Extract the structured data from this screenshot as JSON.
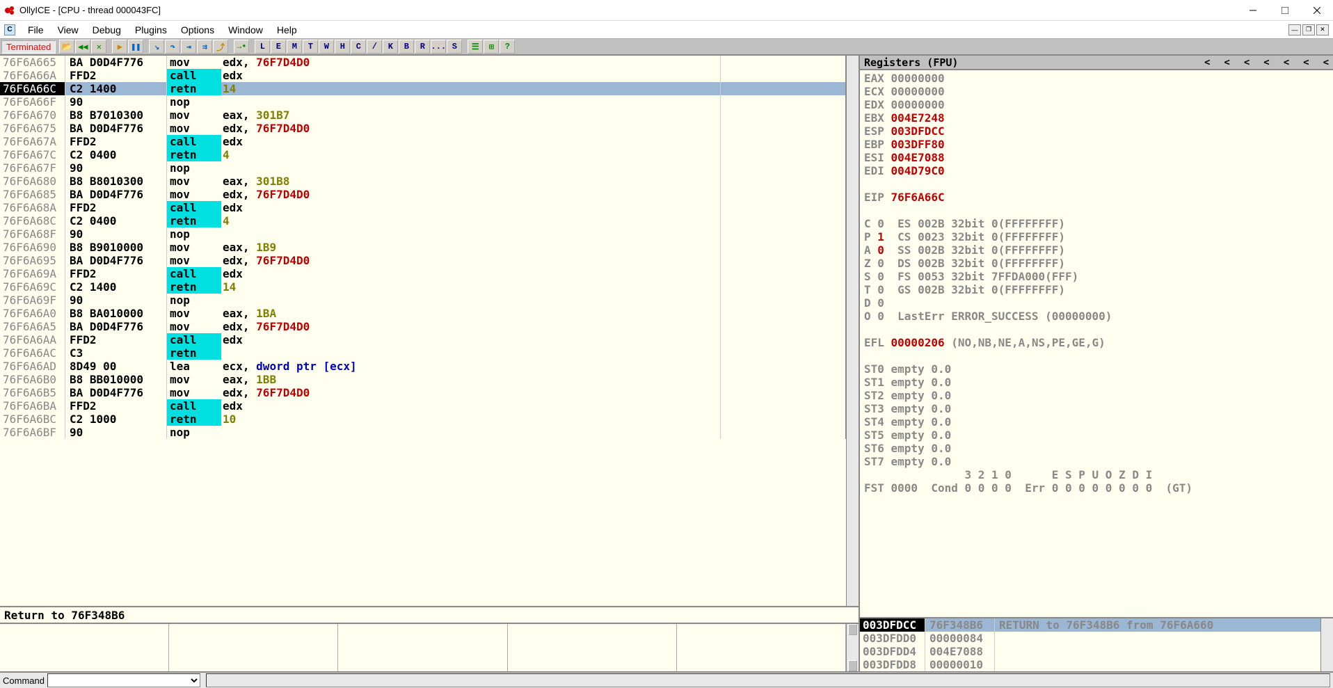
{
  "window": {
    "title": "OllyICE - [CPU - thread 000043FC]"
  },
  "menu": [
    "File",
    "View",
    "Debug",
    "Plugins",
    "Options",
    "Window",
    "Help"
  ],
  "status": "Terminated",
  "toolbar_letters": [
    "L",
    "E",
    "M",
    "T",
    "W",
    "H",
    "C",
    "/",
    "K",
    "B",
    "R",
    "...",
    "S"
  ],
  "disasm": [
    {
      "addr": "76F6A665",
      "bytes": "BA D0D4F776",
      "mnem": "mov",
      "ops": [
        {
          "t": "reg",
          "v": "edx"
        },
        {
          "t": "txt",
          "v": ", "
        },
        {
          "t": "addrv",
          "v": "76F7D4D0"
        }
      ]
    },
    {
      "addr": "76F6A66A",
      "bytes": "FFD2",
      "mnem": "call",
      "hl": true,
      "ops": [
        {
          "t": "reg",
          "v": "edx"
        }
      ]
    },
    {
      "addr": "76F6A66C",
      "bytes": "C2 1400",
      "mnem": "retn",
      "hl": true,
      "sel": true,
      "ops": [
        {
          "t": "imm",
          "v": "14"
        }
      ]
    },
    {
      "addr": "76F6A66F",
      "bytes": "90",
      "mnem": "nop",
      "ops": []
    },
    {
      "addr": "76F6A670",
      "bytes": "B8 B7010300",
      "mnem": "mov",
      "ops": [
        {
          "t": "reg",
          "v": "eax"
        },
        {
          "t": "txt",
          "v": ", "
        },
        {
          "t": "imm",
          "v": "301B7"
        }
      ]
    },
    {
      "addr": "76F6A675",
      "bytes": "BA D0D4F776",
      "mnem": "mov",
      "ops": [
        {
          "t": "reg",
          "v": "edx"
        },
        {
          "t": "txt",
          "v": ", "
        },
        {
          "t": "addrv",
          "v": "76F7D4D0"
        }
      ]
    },
    {
      "addr": "76F6A67A",
      "bytes": "FFD2",
      "mnem": "call",
      "hl": true,
      "ops": [
        {
          "t": "reg",
          "v": "edx"
        }
      ]
    },
    {
      "addr": "76F6A67C",
      "bytes": "C2 0400",
      "mnem": "retn",
      "hl": true,
      "ops": [
        {
          "t": "imm",
          "v": "4"
        }
      ]
    },
    {
      "addr": "76F6A67F",
      "bytes": "90",
      "mnem": "nop",
      "ops": []
    },
    {
      "addr": "76F6A680",
      "bytes": "B8 B8010300",
      "mnem": "mov",
      "ops": [
        {
          "t": "reg",
          "v": "eax"
        },
        {
          "t": "txt",
          "v": ", "
        },
        {
          "t": "imm",
          "v": "301B8"
        }
      ]
    },
    {
      "addr": "76F6A685",
      "bytes": "BA D0D4F776",
      "mnem": "mov",
      "ops": [
        {
          "t": "reg",
          "v": "edx"
        },
        {
          "t": "txt",
          "v": ", "
        },
        {
          "t": "addrv",
          "v": "76F7D4D0"
        }
      ]
    },
    {
      "addr": "76F6A68A",
      "bytes": "FFD2",
      "mnem": "call",
      "hl": true,
      "ops": [
        {
          "t": "reg",
          "v": "edx"
        }
      ]
    },
    {
      "addr": "76F6A68C",
      "bytes": "C2 0400",
      "mnem": "retn",
      "hl": true,
      "ops": [
        {
          "t": "imm",
          "v": "4"
        }
      ]
    },
    {
      "addr": "76F6A68F",
      "bytes": "90",
      "mnem": "nop",
      "ops": []
    },
    {
      "addr": "76F6A690",
      "bytes": "B8 B9010000",
      "mnem": "mov",
      "ops": [
        {
          "t": "reg",
          "v": "eax"
        },
        {
          "t": "txt",
          "v": ", "
        },
        {
          "t": "imm",
          "v": "1B9"
        }
      ]
    },
    {
      "addr": "76F6A695",
      "bytes": "BA D0D4F776",
      "mnem": "mov",
      "ops": [
        {
          "t": "reg",
          "v": "edx"
        },
        {
          "t": "txt",
          "v": ", "
        },
        {
          "t": "addrv",
          "v": "76F7D4D0"
        }
      ]
    },
    {
      "addr": "76F6A69A",
      "bytes": "FFD2",
      "mnem": "call",
      "hl": true,
      "ops": [
        {
          "t": "reg",
          "v": "edx"
        }
      ]
    },
    {
      "addr": "76F6A69C",
      "bytes": "C2 1400",
      "mnem": "retn",
      "hl": true,
      "ops": [
        {
          "t": "imm",
          "v": "14"
        }
      ]
    },
    {
      "addr": "76F6A69F",
      "bytes": "90",
      "mnem": "nop",
      "ops": []
    },
    {
      "addr": "76F6A6A0",
      "bytes": "B8 BA010000",
      "mnem": "mov",
      "ops": [
        {
          "t": "reg",
          "v": "eax"
        },
        {
          "t": "txt",
          "v": ", "
        },
        {
          "t": "imm",
          "v": "1BA"
        }
      ]
    },
    {
      "addr": "76F6A6A5",
      "bytes": "BA D0D4F776",
      "mnem": "mov",
      "ops": [
        {
          "t": "reg",
          "v": "edx"
        },
        {
          "t": "txt",
          "v": ", "
        },
        {
          "t": "addrv",
          "v": "76F7D4D0"
        }
      ]
    },
    {
      "addr": "76F6A6AA",
      "bytes": "FFD2",
      "mnem": "call",
      "hl": true,
      "ops": [
        {
          "t": "reg",
          "v": "edx"
        }
      ]
    },
    {
      "addr": "76F6A6AC",
      "bytes": "C3",
      "mnem": "retn",
      "hl": true,
      "ops": []
    },
    {
      "addr": "76F6A6AD",
      "bytes": "8D49 00",
      "mnem": "lea",
      "ops": [
        {
          "t": "reg",
          "v": "ecx"
        },
        {
          "t": "txt",
          "v": ", "
        },
        {
          "t": "ptr",
          "v": "dword ptr [ecx]"
        }
      ]
    },
    {
      "addr": "76F6A6B0",
      "bytes": "B8 BB010000",
      "mnem": "mov",
      "ops": [
        {
          "t": "reg",
          "v": "eax"
        },
        {
          "t": "txt",
          "v": ", "
        },
        {
          "t": "imm",
          "v": "1BB"
        }
      ]
    },
    {
      "addr": "76F6A6B5",
      "bytes": "BA D0D4F776",
      "mnem": "mov",
      "ops": [
        {
          "t": "reg",
          "v": "edx"
        },
        {
          "t": "txt",
          "v": ", "
        },
        {
          "t": "addrv",
          "v": "76F7D4D0"
        }
      ]
    },
    {
      "addr": "76F6A6BA",
      "bytes": "FFD2",
      "mnem": "call",
      "hl": true,
      "ops": [
        {
          "t": "reg",
          "v": "edx"
        }
      ]
    },
    {
      "addr": "76F6A6BC",
      "bytes": "C2 1000",
      "mnem": "retn",
      "hl": true,
      "ops": [
        {
          "t": "imm",
          "v": "10"
        }
      ]
    },
    {
      "addr": "76F6A6BF",
      "bytes": "90",
      "mnem": "nop",
      "ops": []
    }
  ],
  "info": "Return to 76F348B6",
  "registers": {
    "title": "Registers (FPU)",
    "gp": [
      {
        "name": "EAX",
        "val": "00000000",
        "nz": false
      },
      {
        "name": "ECX",
        "val": "00000000",
        "nz": false
      },
      {
        "name": "EDX",
        "val": "00000000",
        "nz": false
      },
      {
        "name": "EBX",
        "val": "004E7248",
        "nz": true
      },
      {
        "name": "ESP",
        "val": "003DFDCC",
        "nz": true
      },
      {
        "name": "EBP",
        "val": "003DFF80",
        "nz": true
      },
      {
        "name": "ESI",
        "val": "004E7088",
        "nz": true
      },
      {
        "name": "EDI",
        "val": "004D79C0",
        "nz": true
      }
    ],
    "eip": {
      "name": "EIP",
      "val": "76F6A66C",
      "nz": true
    },
    "flags": [
      {
        "f": "C",
        "v": "0",
        "seg": "ES 002B 32bit 0(FFFFFFFF)"
      },
      {
        "f": "P",
        "v": "1",
        "seg": "CS 0023 32bit 0(FFFFFFFF)"
      },
      {
        "f": "A",
        "v": "0",
        "seg": "SS 002B 32bit 0(FFFFFFFF)",
        "hlv": true
      },
      {
        "f": "Z",
        "v": "0",
        "seg": "DS 002B 32bit 0(FFFFFFFF)"
      },
      {
        "f": "S",
        "v": "0",
        "seg": "FS 0053 32bit 7FFDA000(FFF)"
      },
      {
        "f": "T",
        "v": "0",
        "seg": "GS 002B 32bit 0(FFFFFFFF)"
      },
      {
        "f": "D",
        "v": "0",
        "seg": ""
      },
      {
        "f": "O",
        "v": "0",
        "seg": "LastErr ERROR_SUCCESS (00000000)"
      }
    ],
    "efl": {
      "val": "00000206",
      "desc": "(NO,NB,NE,A,NS,PE,GE,G)"
    },
    "fpu": [
      "ST0 empty 0.0",
      "ST1 empty 0.0",
      "ST2 empty 0.0",
      "ST3 empty 0.0",
      "ST4 empty 0.0",
      "ST5 empty 0.0",
      "ST6 empty 0.0",
      "ST7 empty 0.0"
    ],
    "fpu_hdr": "               3 2 1 0      E S P U O Z D I",
    "fst": "FST 0000  Cond 0 0 0 0  Err 0 0 0 0 0 0 0 0  (GT)"
  },
  "stack": [
    {
      "addr": "003DFDCC",
      "val": "76F348B6",
      "cmt": "RETURN to 76F348B6 from 76F6A660",
      "sel": true
    },
    {
      "addr": "003DFDD0",
      "val": "00000084",
      "cmt": ""
    },
    {
      "addr": "003DFDD4",
      "val": "004E7088",
      "cmt": ""
    },
    {
      "addr": "003DFDD8",
      "val": "00000010",
      "cmt": ""
    }
  ],
  "command": {
    "label": "Command"
  }
}
